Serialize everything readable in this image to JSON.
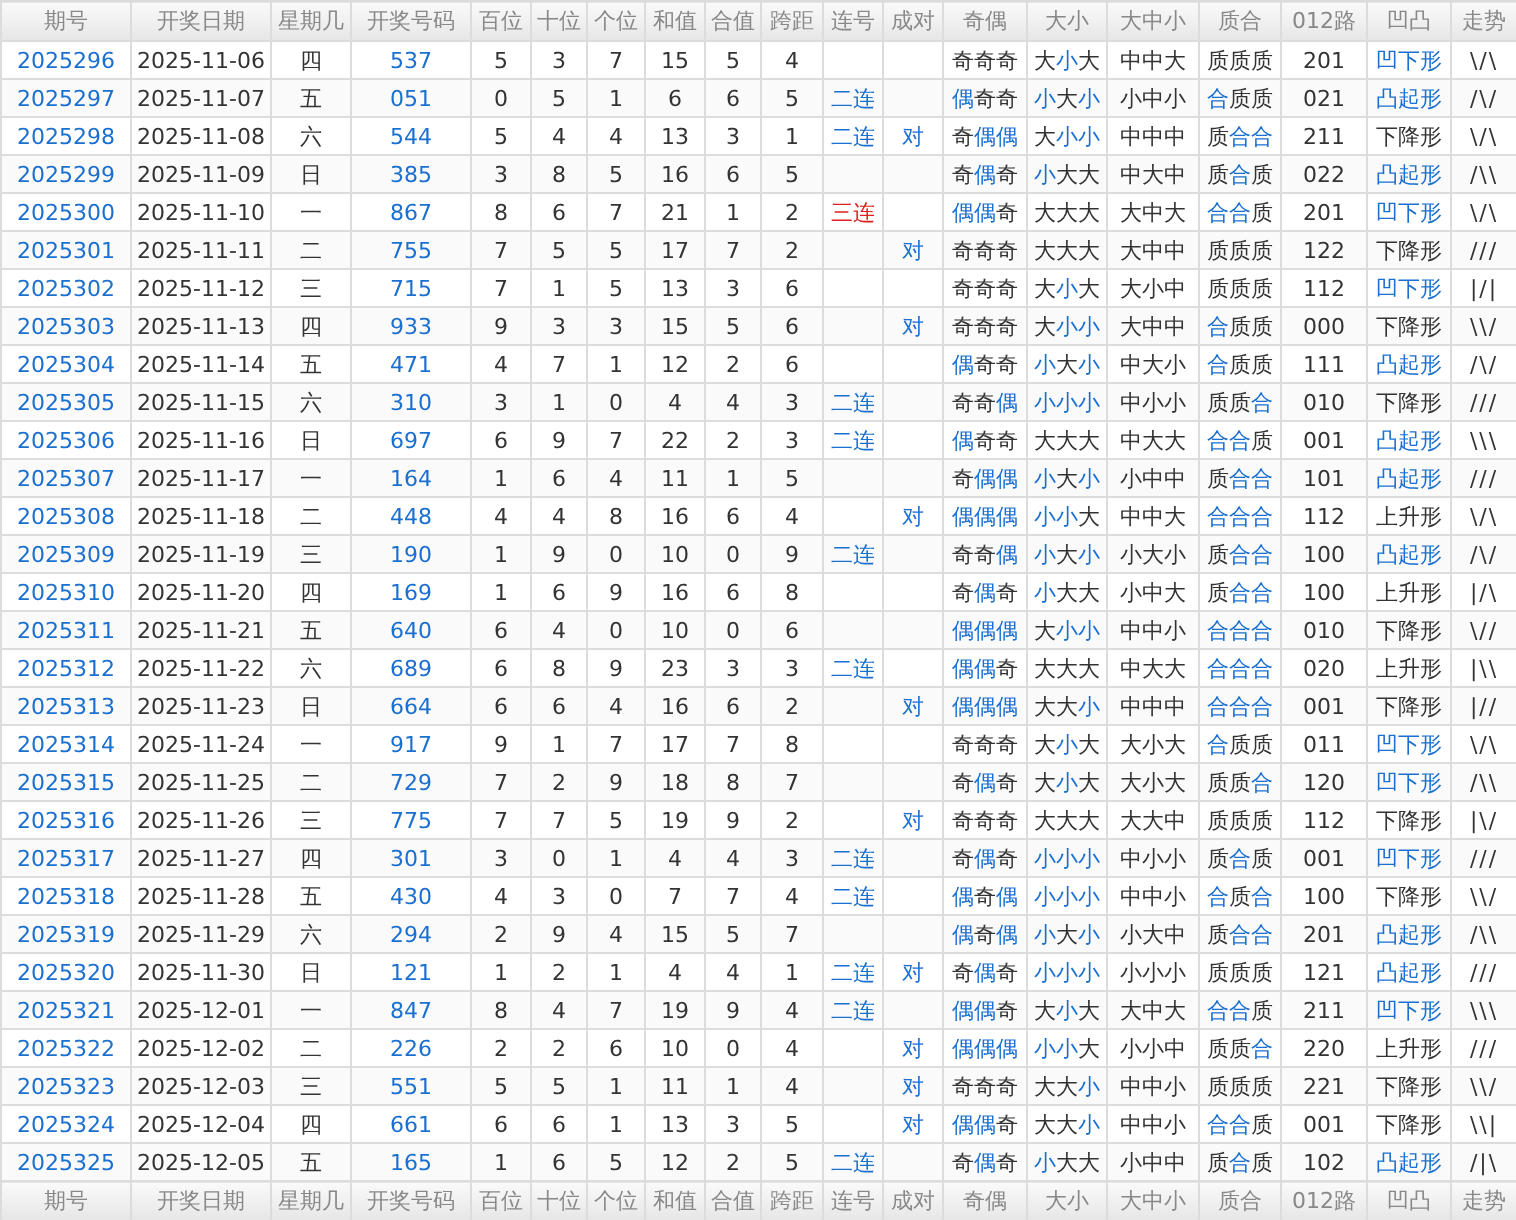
{
  "header": [
    "期号",
    "开奖日期",
    "星期几",
    "开奖号码",
    "百位",
    "十位",
    "个位",
    "和值",
    "合值",
    "跨距",
    "连号",
    "成对",
    "奇偶",
    "大小",
    "大中小",
    "质合",
    "012路",
    "凹凸",
    "走势"
  ],
  "rows": [
    {
      "issue": "2025296",
      "date": "2025-11-06",
      "weekday": "四",
      "number": "537",
      "hundreds": "5",
      "tens": "3",
      "units": "7",
      "sum": "15",
      "sum_tail": "5",
      "span": "4",
      "parity": {
        "text": "奇奇奇",
        "marked": [
          false,
          false,
          false
        ]
      },
      "size": {
        "text": "大小大",
        "marked": [
          false,
          true,
          false
        ]
      },
      "size3": "中中大",
      "prime": {
        "text": "质质质",
        "marked": [
          false,
          false,
          false
        ]
      },
      "route": "201",
      "shape": {
        "text": "凹下形",
        "marked": true
      },
      "trend": "\\/\\"
    },
    {
      "issue": "2025297",
      "date": "2025-11-07",
      "weekday": "五",
      "number": "051",
      "hundreds": "0",
      "tens": "5",
      "units": "1",
      "sum": "6",
      "sum_tail": "6",
      "span": "5",
      "consecutive": {
        "text": "二连",
        "color": "#1a6fd0"
      },
      "parity": {
        "text": "偶奇奇",
        "marked": [
          true,
          false,
          false
        ]
      },
      "size": {
        "text": "小大小",
        "marked": [
          true,
          false,
          true
        ]
      },
      "size3": "小中小",
      "prime": {
        "text": "合质质",
        "marked": [
          true,
          false,
          false
        ]
      },
      "route": "021",
      "shape": {
        "text": "凸起形",
        "marked": true
      },
      "trend": "/\\/"
    },
    {
      "issue": "2025298",
      "date": "2025-11-08",
      "weekday": "六",
      "number": "544",
      "hundreds": "5",
      "tens": "4",
      "units": "4",
      "sum": "13",
      "sum_tail": "3",
      "span": "1",
      "consecutive": {
        "text": "二连",
        "color": "#1a6fd0"
      },
      "pair": "对",
      "parity": {
        "text": "奇偶偶",
        "marked": [
          false,
          true,
          true
        ]
      },
      "size": {
        "text": "大小小",
        "marked": [
          false,
          true,
          true
        ]
      },
      "size3": "中中中",
      "prime": {
        "text": "质合合",
        "marked": [
          false,
          true,
          true
        ]
      },
      "route": "211",
      "shape": {
        "text": "下降形",
        "marked": false
      },
      "trend": "\\/\\"
    },
    {
      "issue": "2025299",
      "date": "2025-11-09",
      "weekday": "日",
      "number": "385",
      "hundreds": "3",
      "tens": "8",
      "units": "5",
      "sum": "16",
      "sum_tail": "6",
      "span": "5",
      "parity": {
        "text": "奇偶奇",
        "marked": [
          false,
          true,
          false
        ]
      },
      "size": {
        "text": "小大大",
        "marked": [
          true,
          false,
          false
        ]
      },
      "size3": "中大中",
      "prime": {
        "text": "质合质",
        "marked": [
          false,
          true,
          false
        ]
      },
      "route": "022",
      "shape": {
        "text": "凸起形",
        "marked": true
      },
      "trend": "/\\\\"
    },
    {
      "issue": "2025300",
      "date": "2025-11-10",
      "weekday": "一",
      "number": "867",
      "hundreds": "8",
      "tens": "6",
      "units": "7",
      "sum": "21",
      "sum_tail": "1",
      "span": "2",
      "consecutive": {
        "text": "三连",
        "color": "#e02020"
      },
      "parity": {
        "text": "偶偶奇",
        "marked": [
          true,
          true,
          false
        ]
      },
      "size": {
        "text": "大大大",
        "marked": [
          false,
          false,
          false
        ]
      },
      "size3": "大中大",
      "prime": {
        "text": "合合质",
        "marked": [
          true,
          true,
          false
        ]
      },
      "route": "201",
      "shape": {
        "text": "凹下形",
        "marked": true
      },
      "trend": "\\/\\"
    },
    {
      "issue": "2025301",
      "date": "2025-11-11",
      "weekday": "二",
      "number": "755",
      "hundreds": "7",
      "tens": "5",
      "units": "5",
      "sum": "17",
      "sum_tail": "7",
      "span": "2",
      "pair": "对",
      "parity": {
        "text": "奇奇奇",
        "marked": [
          false,
          false,
          false
        ]
      },
      "size": {
        "text": "大大大",
        "marked": [
          false,
          false,
          false
        ]
      },
      "size3": "大中中",
      "prime": {
        "text": "质质质",
        "marked": [
          false,
          false,
          false
        ]
      },
      "route": "122",
      "shape": {
        "text": "下降形",
        "marked": false
      },
      "trend": "///"
    },
    {
      "issue": "2025302",
      "date": "2025-11-12",
      "weekday": "三",
      "number": "715",
      "hundreds": "7",
      "tens": "1",
      "units": "5",
      "sum": "13",
      "sum_tail": "3",
      "span": "6",
      "parity": {
        "text": "奇奇奇",
        "marked": [
          false,
          false,
          false
        ]
      },
      "size": {
        "text": "大小大",
        "marked": [
          false,
          true,
          false
        ]
      },
      "size3": "大小中",
      "prime": {
        "text": "质质质",
        "marked": [
          false,
          false,
          false
        ]
      },
      "route": "112",
      "shape": {
        "text": "凹下形",
        "marked": true
      },
      "trend": "|/|"
    },
    {
      "issue": "2025303",
      "date": "2025-11-13",
      "weekday": "四",
      "number": "933",
      "hundreds": "9",
      "tens": "3",
      "units": "3",
      "sum": "15",
      "sum_tail": "5",
      "span": "6",
      "pair": "对",
      "parity": {
        "text": "奇奇奇",
        "marked": [
          false,
          false,
          false
        ]
      },
      "size": {
        "text": "大小小",
        "marked": [
          false,
          true,
          true
        ]
      },
      "size3": "大中中",
      "prime": {
        "text": "合质质",
        "marked": [
          true,
          false,
          false
        ]
      },
      "route": "000",
      "shape": {
        "text": "下降形",
        "marked": false
      },
      "trend": "\\\\/"
    },
    {
      "issue": "2025304",
      "date": "2025-11-14",
      "weekday": "五",
      "number": "471",
      "hundreds": "4",
      "tens": "7",
      "units": "1",
      "sum": "12",
      "sum_tail": "2",
      "span": "6",
      "parity": {
        "text": "偶奇奇",
        "marked": [
          true,
          false,
          false
        ]
      },
      "size": {
        "text": "小大小",
        "marked": [
          true,
          false,
          true
        ]
      },
      "size3": "中大小",
      "prime": {
        "text": "合质质",
        "marked": [
          true,
          false,
          false
        ]
      },
      "route": "111",
      "shape": {
        "text": "凸起形",
        "marked": true
      },
      "trend": "/\\/"
    },
    {
      "issue": "2025305",
      "date": "2025-11-15",
      "weekday": "六",
      "number": "310",
      "hundreds": "3",
      "tens": "1",
      "units": "0",
      "sum": "4",
      "sum_tail": "4",
      "span": "3",
      "consecutive": {
        "text": "二连",
        "color": "#1a6fd0"
      },
      "parity": {
        "text": "奇奇偶",
        "marked": [
          false,
          false,
          true
        ]
      },
      "size": {
        "text": "小小小",
        "marked": [
          true,
          true,
          true
        ]
      },
      "size3": "中小小",
      "prime": {
        "text": "质质合",
        "marked": [
          false,
          false,
          true
        ]
      },
      "route": "010",
      "shape": {
        "text": "下降形",
        "marked": false
      },
      "trend": "///"
    },
    {
      "issue": "2025306",
      "date": "2025-11-16",
      "weekday": "日",
      "number": "697",
      "hundreds": "6",
      "tens": "9",
      "units": "7",
      "sum": "22",
      "sum_tail": "2",
      "span": "3",
      "consecutive": {
        "text": "二连",
        "color": "#1a6fd0"
      },
      "parity": {
        "text": "偶奇奇",
        "marked": [
          true,
          false,
          false
        ]
      },
      "size": {
        "text": "大大大",
        "marked": [
          false,
          false,
          false
        ]
      },
      "size3": "中大大",
      "prime": {
        "text": "合合质",
        "marked": [
          true,
          true,
          false
        ]
      },
      "route": "001",
      "shape": {
        "text": "凸起形",
        "marked": true
      },
      "trend": "\\\\\\"
    },
    {
      "issue": "2025307",
      "date": "2025-11-17",
      "weekday": "一",
      "number": "164",
      "hundreds": "1",
      "tens": "6",
      "units": "4",
      "sum": "11",
      "sum_tail": "1",
      "span": "5",
      "parity": {
        "text": "奇偶偶",
        "marked": [
          false,
          true,
          true
        ]
      },
      "size": {
        "text": "小大小",
        "marked": [
          true,
          false,
          true
        ]
      },
      "size3": "小中中",
      "prime": {
        "text": "质合合",
        "marked": [
          false,
          true,
          true
        ]
      },
      "route": "101",
      "shape": {
        "text": "凸起形",
        "marked": true
      },
      "trend": "///"
    },
    {
      "issue": "2025308",
      "date": "2025-11-18",
      "weekday": "二",
      "number": "448",
      "hundreds": "4",
      "tens": "4",
      "units": "8",
      "sum": "16",
      "sum_tail": "6",
      "span": "4",
      "pair": "对",
      "parity": {
        "text": "偶偶偶",
        "marked": [
          true,
          true,
          true
        ]
      },
      "size": {
        "text": "小小大",
        "marked": [
          true,
          true,
          false
        ]
      },
      "size3": "中中大",
      "prime": {
        "text": "合合合",
        "marked": [
          true,
          true,
          true
        ]
      },
      "route": "112",
      "shape": {
        "text": "上升形",
        "marked": false
      },
      "trend": "\\/\\"
    },
    {
      "issue": "2025309",
      "date": "2025-11-19",
      "weekday": "三",
      "number": "190",
      "hundreds": "1",
      "tens": "9",
      "units": "0",
      "sum": "10",
      "sum_tail": "0",
      "span": "9",
      "consecutive": {
        "text": "二连",
        "color": "#1a6fd0"
      },
      "parity": {
        "text": "奇奇偶",
        "marked": [
          false,
          false,
          true
        ]
      },
      "size": {
        "text": "小大小",
        "marked": [
          true,
          false,
          true
        ]
      },
      "size3": "小大小",
      "prime": {
        "text": "质合合",
        "marked": [
          false,
          true,
          true
        ]
      },
      "route": "100",
      "shape": {
        "text": "凸起形",
        "marked": true
      },
      "trend": "/\\/"
    },
    {
      "issue": "2025310",
      "date": "2025-11-20",
      "weekday": "四",
      "number": "169",
      "hundreds": "1",
      "tens": "6",
      "units": "9",
      "sum": "16",
      "sum_tail": "6",
      "span": "8",
      "parity": {
        "text": "奇偶奇",
        "marked": [
          false,
          true,
          false
        ]
      },
      "size": {
        "text": "小大大",
        "marked": [
          true,
          false,
          false
        ]
      },
      "size3": "小中大",
      "prime": {
        "text": "质合合",
        "marked": [
          false,
          true,
          true
        ]
      },
      "route": "100",
      "shape": {
        "text": "上升形",
        "marked": false
      },
      "trend": "|/\\"
    },
    {
      "issue": "2025311",
      "date": "2025-11-21",
      "weekday": "五",
      "number": "640",
      "hundreds": "6",
      "tens": "4",
      "units": "0",
      "sum": "10",
      "sum_tail": "0",
      "span": "6",
      "parity": {
        "text": "偶偶偶",
        "marked": [
          true,
          true,
          true
        ]
      },
      "size": {
        "text": "大小小",
        "marked": [
          false,
          true,
          true
        ]
      },
      "size3": "中中小",
      "prime": {
        "text": "合合合",
        "marked": [
          true,
          true,
          true
        ]
      },
      "route": "010",
      "shape": {
        "text": "下降形",
        "marked": false
      },
      "trend": "\\//"
    },
    {
      "issue": "2025312",
      "date": "2025-11-22",
      "weekday": "六",
      "number": "689",
      "hundreds": "6",
      "tens": "8",
      "units": "9",
      "sum": "23",
      "sum_tail": "3",
      "span": "3",
      "consecutive": {
        "text": "二连",
        "color": "#1a6fd0"
      },
      "parity": {
        "text": "偶偶奇",
        "marked": [
          true,
          true,
          false
        ]
      },
      "size": {
        "text": "大大大",
        "marked": [
          false,
          false,
          false
        ]
      },
      "size3": "中大大",
      "prime": {
        "text": "合合合",
        "marked": [
          true,
          true,
          true
        ]
      },
      "route": "020",
      "shape": {
        "text": "上升形",
        "marked": false
      },
      "trend": "|\\\\"
    },
    {
      "issue": "2025313",
      "date": "2025-11-23",
      "weekday": "日",
      "number": "664",
      "hundreds": "6",
      "tens": "6",
      "units": "4",
      "sum": "16",
      "sum_tail": "6",
      "span": "2",
      "pair": "对",
      "parity": {
        "text": "偶偶偶",
        "marked": [
          true,
          true,
          true
        ]
      },
      "size": {
        "text": "大大小",
        "marked": [
          false,
          false,
          true
        ]
      },
      "size3": "中中中",
      "prime": {
        "text": "合合合",
        "marked": [
          true,
          true,
          true
        ]
      },
      "route": "001",
      "shape": {
        "text": "下降形",
        "marked": false
      },
      "trend": "|//"
    },
    {
      "issue": "2025314",
      "date": "2025-11-24",
      "weekday": "一",
      "number": "917",
      "hundreds": "9",
      "tens": "1",
      "units": "7",
      "sum": "17",
      "sum_tail": "7",
      "span": "8",
      "parity": {
        "text": "奇奇奇",
        "marked": [
          false,
          false,
          false
        ]
      },
      "size": {
        "text": "大小大",
        "marked": [
          false,
          true,
          false
        ]
      },
      "size3": "大小大",
      "prime": {
        "text": "合质质",
        "marked": [
          true,
          false,
          false
        ]
      },
      "route": "011",
      "shape": {
        "text": "凹下形",
        "marked": true
      },
      "trend": "\\/\\"
    },
    {
      "issue": "2025315",
      "date": "2025-11-25",
      "weekday": "二",
      "number": "729",
      "hundreds": "7",
      "tens": "2",
      "units": "9",
      "sum": "18",
      "sum_tail": "8",
      "span": "7",
      "parity": {
        "text": "奇偶奇",
        "marked": [
          false,
          true,
          false
        ]
      },
      "size": {
        "text": "大小大",
        "marked": [
          false,
          true,
          false
        ]
      },
      "size3": "大小大",
      "prime": {
        "text": "质质合",
        "marked": [
          false,
          false,
          true
        ]
      },
      "route": "120",
      "shape": {
        "text": "凹下形",
        "marked": true
      },
      "trend": "/\\\\"
    },
    {
      "issue": "2025316",
      "date": "2025-11-26",
      "weekday": "三",
      "number": "775",
      "hundreds": "7",
      "tens": "7",
      "units": "5",
      "sum": "19",
      "sum_tail": "9",
      "span": "2",
      "pair": "对",
      "parity": {
        "text": "奇奇奇",
        "marked": [
          false,
          false,
          false
        ]
      },
      "size": {
        "text": "大大大",
        "marked": [
          false,
          false,
          false
        ]
      },
      "size3": "大大中",
      "prime": {
        "text": "质质质",
        "marked": [
          false,
          false,
          false
        ]
      },
      "route": "112",
      "shape": {
        "text": "下降形",
        "marked": false
      },
      "trend": "|\\/"
    },
    {
      "issue": "2025317",
      "date": "2025-11-27",
      "weekday": "四",
      "number": "301",
      "hundreds": "3",
      "tens": "0",
      "units": "1",
      "sum": "4",
      "sum_tail": "4",
      "span": "3",
      "consecutive": {
        "text": "二连",
        "color": "#1a6fd0"
      },
      "parity": {
        "text": "奇偶奇",
        "marked": [
          false,
          true,
          false
        ]
      },
      "size": {
        "text": "小小小",
        "marked": [
          true,
          true,
          true
        ]
      },
      "size3": "中小小",
      "prime": {
        "text": "质合质",
        "marked": [
          false,
          true,
          false
        ]
      },
      "route": "001",
      "shape": {
        "text": "凹下形",
        "marked": true
      },
      "trend": "///"
    },
    {
      "issue": "2025318",
      "date": "2025-11-28",
      "weekday": "五",
      "number": "430",
      "hundreds": "4",
      "tens": "3",
      "units": "0",
      "sum": "7",
      "sum_tail": "7",
      "span": "4",
      "consecutive": {
        "text": "二连",
        "color": "#1a6fd0"
      },
      "parity": {
        "text": "偶奇偶",
        "marked": [
          true,
          false,
          true
        ]
      },
      "size": {
        "text": "小小小",
        "marked": [
          true,
          true,
          true
        ]
      },
      "size3": "中中小",
      "prime": {
        "text": "合质合",
        "marked": [
          true,
          false,
          true
        ]
      },
      "route": "100",
      "shape": {
        "text": "下降形",
        "marked": false
      },
      "trend": "\\\\/"
    },
    {
      "issue": "2025319",
      "date": "2025-11-29",
      "weekday": "六",
      "number": "294",
      "hundreds": "2",
      "tens": "9",
      "units": "4",
      "sum": "15",
      "sum_tail": "5",
      "span": "7",
      "parity": {
        "text": "偶奇偶",
        "marked": [
          true,
          false,
          true
        ]
      },
      "size": {
        "text": "小大小",
        "marked": [
          true,
          false,
          true
        ]
      },
      "size3": "小大中",
      "prime": {
        "text": "质合合",
        "marked": [
          false,
          true,
          true
        ]
      },
      "route": "201",
      "shape": {
        "text": "凸起形",
        "marked": true
      },
      "trend": "/\\\\"
    },
    {
      "issue": "2025320",
      "date": "2025-11-30",
      "weekday": "日",
      "number": "121",
      "hundreds": "1",
      "tens": "2",
      "units": "1",
      "sum": "4",
      "sum_tail": "4",
      "span": "1",
      "consecutive": {
        "text": "二连",
        "color": "#1a6fd0"
      },
      "pair": "对",
      "parity": {
        "text": "奇偶奇",
        "marked": [
          false,
          true,
          false
        ]
      },
      "size": {
        "text": "小小小",
        "marked": [
          true,
          true,
          true
        ]
      },
      "size3": "小小小",
      "prime": {
        "text": "质质质",
        "marked": [
          false,
          false,
          false
        ]
      },
      "route": "121",
      "shape": {
        "text": "凸起形",
        "marked": true
      },
      "trend": "///"
    },
    {
      "issue": "2025321",
      "date": "2025-12-01",
      "weekday": "一",
      "number": "847",
      "hundreds": "8",
      "tens": "4",
      "units": "7",
      "sum": "19",
      "sum_tail": "9",
      "span": "4",
      "consecutive": {
        "text": "二连",
        "color": "#1a6fd0"
      },
      "parity": {
        "text": "偶偶奇",
        "marked": [
          true,
          true,
          false
        ]
      },
      "size": {
        "text": "大小大",
        "marked": [
          false,
          true,
          false
        ]
      },
      "size3": "大中大",
      "prime": {
        "text": "合合质",
        "marked": [
          true,
          true,
          false
        ]
      },
      "route": "211",
      "shape": {
        "text": "凹下形",
        "marked": true
      },
      "trend": "\\\\\\"
    },
    {
      "issue": "2025322",
      "date": "2025-12-02",
      "weekday": "二",
      "number": "226",
      "hundreds": "2",
      "tens": "2",
      "units": "6",
      "sum": "10",
      "sum_tail": "0",
      "span": "4",
      "pair": "对",
      "parity": {
        "text": "偶偶偶",
        "marked": [
          true,
          true,
          true
        ]
      },
      "size": {
        "text": "小小大",
        "marked": [
          true,
          true,
          false
        ]
      },
      "size3": "小小中",
      "prime": {
        "text": "质质合",
        "marked": [
          false,
          false,
          true
        ]
      },
      "route": "220",
      "shape": {
        "text": "上升形",
        "marked": false
      },
      "trend": "///"
    },
    {
      "issue": "2025323",
      "date": "2025-12-03",
      "weekday": "三",
      "number": "551",
      "hundreds": "5",
      "tens": "5",
      "units": "1",
      "sum": "11",
      "sum_tail": "1",
      "span": "4",
      "pair": "对",
      "parity": {
        "text": "奇奇奇",
        "marked": [
          false,
          false,
          false
        ]
      },
      "size": {
        "text": "大大小",
        "marked": [
          false,
          false,
          true
        ]
      },
      "size3": "中中小",
      "prime": {
        "text": "质质质",
        "marked": [
          false,
          false,
          false
        ]
      },
      "route": "221",
      "shape": {
        "text": "下降形",
        "marked": false
      },
      "trend": "\\\\/"
    },
    {
      "issue": "2025324",
      "date": "2025-12-04",
      "weekday": "四",
      "number": "661",
      "hundreds": "6",
      "tens": "6",
      "units": "1",
      "sum": "13",
      "sum_tail": "3",
      "span": "5",
      "pair": "对",
      "parity": {
        "text": "偶偶奇",
        "marked": [
          true,
          true,
          false
        ]
      },
      "size": {
        "text": "大大小",
        "marked": [
          false,
          false,
          true
        ]
      },
      "size3": "中中小",
      "prime": {
        "text": "合合质",
        "marked": [
          true,
          true,
          false
        ]
      },
      "route": "001",
      "shape": {
        "text": "下降形",
        "marked": false
      },
      "trend": "\\\\|"
    },
    {
      "issue": "2025325",
      "date": "2025-12-05",
      "weekday": "五",
      "number": "165",
      "hundreds": "1",
      "tens": "6",
      "units": "5",
      "sum": "12",
      "sum_tail": "2",
      "span": "5",
      "consecutive": {
        "text": "二连",
        "color": "#1a6fd0"
      },
      "parity": {
        "text": "奇偶奇",
        "marked": [
          false,
          true,
          false
        ]
      },
      "size": {
        "text": "小大大",
        "marked": [
          true,
          false,
          false
        ]
      },
      "size3": "小中中",
      "prime": {
        "text": "质合质",
        "marked": [
          false,
          true,
          false
        ]
      },
      "route": "102",
      "shape": {
        "text": "凸起形",
        "marked": true
      },
      "trend": "/|\\"
    }
  ],
  "footer": [
    "期号",
    "开奖日期",
    "星期几",
    "开奖号码",
    "百位",
    "十位",
    "个位",
    "和值",
    "合值",
    "跨距",
    "连号",
    "成对",
    "奇偶",
    "大小",
    "大中小",
    "质合",
    "012路",
    "凹凸",
    "走势"
  ]
}
